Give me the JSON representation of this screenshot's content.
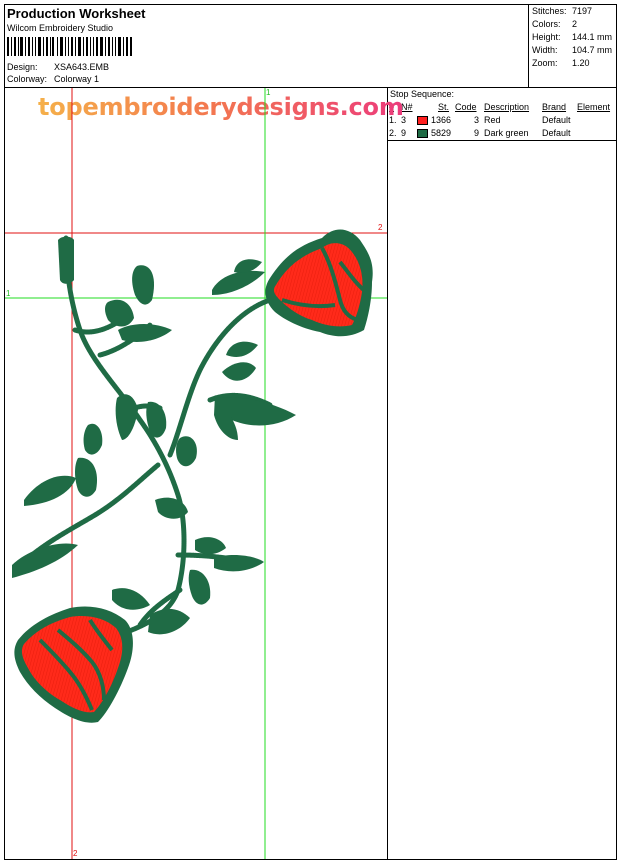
{
  "header": {
    "title": "Production Worksheet",
    "software": "Wilcom  Embroidery Studio",
    "design_label": "Design:",
    "design_value": "XSA643.EMB",
    "colorway_label": "Colorway:",
    "colorway_value": "Colorway 1"
  },
  "stats": [
    {
      "label": "Stitches:",
      "value": "7197"
    },
    {
      "label": "Colors:",
      "value": "2"
    },
    {
      "label": "Height:",
      "value": "144.1 mm"
    },
    {
      "label": "Width:",
      "value": "104.7 mm"
    },
    {
      "label": "Zoom:",
      "value": "1.20"
    }
  ],
  "watermark": "topembroiderydesigns.com",
  "stop_sequence": {
    "title": "Stop Sequence:",
    "columns": {
      "num": "#",
      "needle": "N#",
      "stitches": "St.",
      "code": "Code",
      "description": "Description",
      "brand": "Brand",
      "element": "Element"
    },
    "rows": [
      {
        "num": "1.",
        "needle": "3",
        "color": "#ff1f1f",
        "stitches": "1366",
        "code": "3",
        "description": "Red",
        "brand": "Default",
        "element": ""
      },
      {
        "num": "2.",
        "needle": "9",
        "color": "#1f6b45",
        "stitches": "5829",
        "code": "9",
        "description": "Dark green",
        "brand": "Default",
        "element": ""
      }
    ]
  },
  "guides": {
    "red_vertical_top": "",
    "red_vertical_bottom": "2",
    "red_horizontal_right": "2",
    "green_vertical_top": "1",
    "green_horizontal_left": "1"
  },
  "colors": {
    "thread_red": "#ff1f1f",
    "thread_green": "#1f6b45",
    "guide_red": "#e01010",
    "guide_green": "#22dd22"
  }
}
